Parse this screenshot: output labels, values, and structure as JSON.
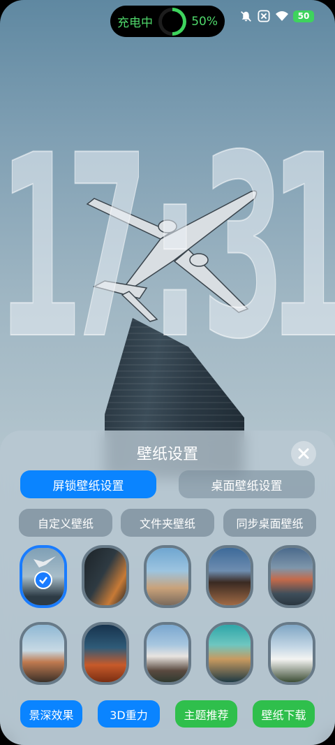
{
  "status": {
    "charging_label": "充电中",
    "charging_percent": "50%",
    "battery_level": "50",
    "charge_progress": 0.5,
    "icons": [
      "bell-muted-icon",
      "close-box-icon",
      "wifi-icon",
      "battery-icon"
    ]
  },
  "clock": {
    "time": "17:31"
  },
  "panel": {
    "title": "壁纸设置",
    "tabs": [
      {
        "label": "屏锁壁纸设置",
        "active": true
      },
      {
        "label": "桌面壁纸设置",
        "active": false
      }
    ],
    "chips": [
      "自定义壁纸",
      "文件夹壁纸",
      "同步桌面壁纸"
    ],
    "wallpapers_row1": [
      "airplane-building",
      "dark-skyscraper",
      "flatiron-building",
      "pagoda-street",
      "mountain-sunset"
    ],
    "wallpapers_row2": [
      "snowy-peak",
      "desert-dunes",
      "mountain-range",
      "alpine-lake",
      "white-flowers"
    ],
    "actions": [
      {
        "label": "景深效果",
        "color": "#0a84ff"
      },
      {
        "label": "3D重力",
        "color": "#0a84ff"
      },
      {
        "label": "主题推荐",
        "color": "#2fbf4c"
      },
      {
        "label": "壁纸下载",
        "color": "#2fbf4c"
      }
    ]
  }
}
